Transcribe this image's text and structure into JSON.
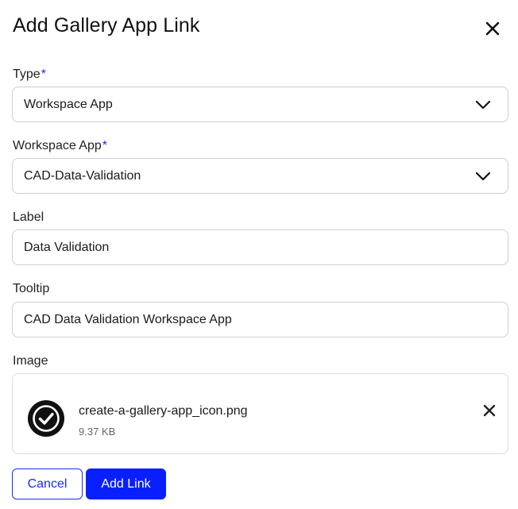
{
  "dialog": {
    "title": "Add Gallery App Link"
  },
  "fields": {
    "type": {
      "label": "Type",
      "required_marker": "*",
      "value": "Workspace App"
    },
    "workspace_app": {
      "label": "Workspace App",
      "required_marker": "*",
      "value": "CAD-Data-Validation"
    },
    "label": {
      "label": "Label",
      "value": "Data Validation"
    },
    "tooltip": {
      "label": "Tooltip",
      "value": "CAD Data Validation Workspace App"
    },
    "image": {
      "label": "Image",
      "file_name": "create-a-gallery-app_icon.png",
      "file_size": "9.37 KB",
      "icon": "check-circle-icon"
    }
  },
  "actions": {
    "cancel_label": "Cancel",
    "add_label": "Add Link"
  },
  "colors": {
    "accent": "#0a1fff",
    "required": "#1a2cff",
    "border": "#cfcfcf"
  }
}
